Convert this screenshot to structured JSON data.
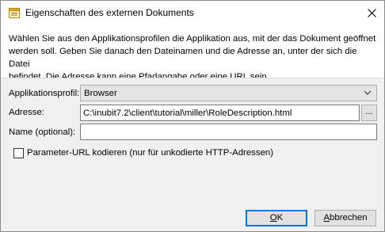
{
  "window": {
    "title": "Eigenschaften des externen Dokuments",
    "icon": "document-properties-icon",
    "accent_color": "#0078d7"
  },
  "description": {
    "line1": "Wählen Sie aus den Applikationsprofilen die Applikation aus, mit der das Dokument geöffnet",
    "line2": "werden soll. Geben Sie danach den Dateinamen und die Adresse an, unter der sich die Datei",
    "line3": "befindet. Die Adresse kann eine Pfadangabe oder eine URL sein."
  },
  "form": {
    "profile_label": "Applikationsprofil:",
    "profile_value": "Browser",
    "address_label": "Adresse:",
    "address_value": "C:\\inubit7.2\\client\\tutorial\\miller\\RoleDescription.html",
    "browse_label": "...",
    "name_label": "Name (optional):",
    "name_value": "",
    "checkbox_label": "Parameter-URL kodieren (nur für unkodierte HTTP-Adressen)",
    "checkbox_checked": false
  },
  "buttons": {
    "ok_mnemonic": "O",
    "ok_rest": "K",
    "cancel_mnemonic": "A",
    "cancel_rest": "bbrechen"
  }
}
